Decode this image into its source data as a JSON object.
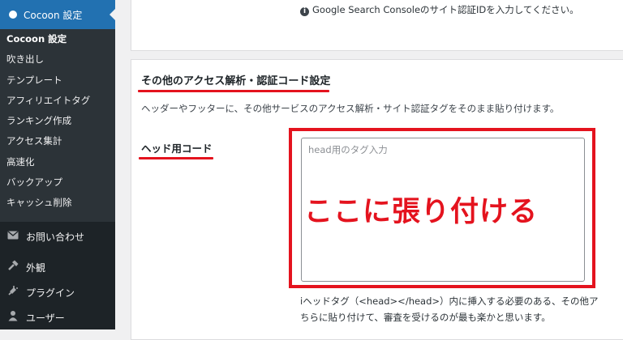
{
  "sidebar": {
    "active_menu": "Cocoon 設定",
    "submenu": [
      "Cocoon 設定",
      "吹き出し",
      "テンプレート",
      "アフィリエイトタグ",
      "ランキング作成",
      "アクセス集計",
      "高速化",
      "バックアップ",
      "キャッシュ削除"
    ],
    "items": [
      {
        "icon": "mail-icon",
        "label": "お問い合わせ"
      },
      {
        "icon": "hammer-icon",
        "label": "外観"
      },
      {
        "icon": "plugin-icon",
        "label": "プラグイン"
      },
      {
        "icon": "user-icon",
        "label": "ユーザー"
      }
    ]
  },
  "top_hint": "Google Search Consoleのサイト認証IDを入力してください。",
  "section": {
    "title": "その他のアクセス解析・認証コード設定",
    "description": "ヘッダーやフッターに、その他サービスのアクセス解析・サイト認証タグをそのまま貼り付けます。",
    "field_label": "ヘッド用コード",
    "textarea_placeholder": "head用のタグ入力",
    "textarea_value": "",
    "note_line1": "ヘッドタグ（<head></head>）内に挿入する必要のある、その他ア",
    "note_line2": "ちらに貼り付けて、審査を受けるのが最も楽かと思います。"
  },
  "annotation": {
    "callout": "ここに張り付ける",
    "color": "#e4131e"
  },
  "colors": {
    "sidebar_bg": "#1d2327",
    "submenu_bg": "#2c3338",
    "active_bg": "#2271b1"
  }
}
